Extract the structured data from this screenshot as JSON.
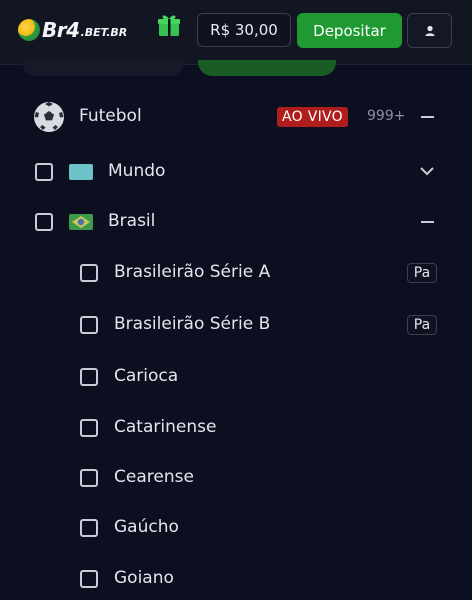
{
  "header": {
    "logo_text": "Br4",
    "logo_suffix": ".BET.BR",
    "gift_icon": "gift-icon",
    "balance": "R$ 30,00",
    "deposit_label": "Depositar",
    "user_icon": "user-icon",
    "accent_color": "#1f9a33"
  },
  "sports": {
    "sport_name": "Futebol",
    "live_label": "AO VIVO",
    "count": "999+",
    "live_color": "#b01d1d",
    "regions": [
      {
        "label": "Mundo",
        "state": "collapsed"
      },
      {
        "label": "Brasil",
        "state": "expanded"
      }
    ],
    "leagues": [
      {
        "label": "Brasileirão Série A",
        "badge": "Pa"
      },
      {
        "label": "Brasileirão Série B",
        "badge": "Pa"
      },
      {
        "label": "Carioca"
      },
      {
        "label": "Catarinense"
      },
      {
        "label": "Cearense"
      },
      {
        "label": "Gaúcho"
      },
      {
        "label": "Goiano"
      }
    ]
  }
}
